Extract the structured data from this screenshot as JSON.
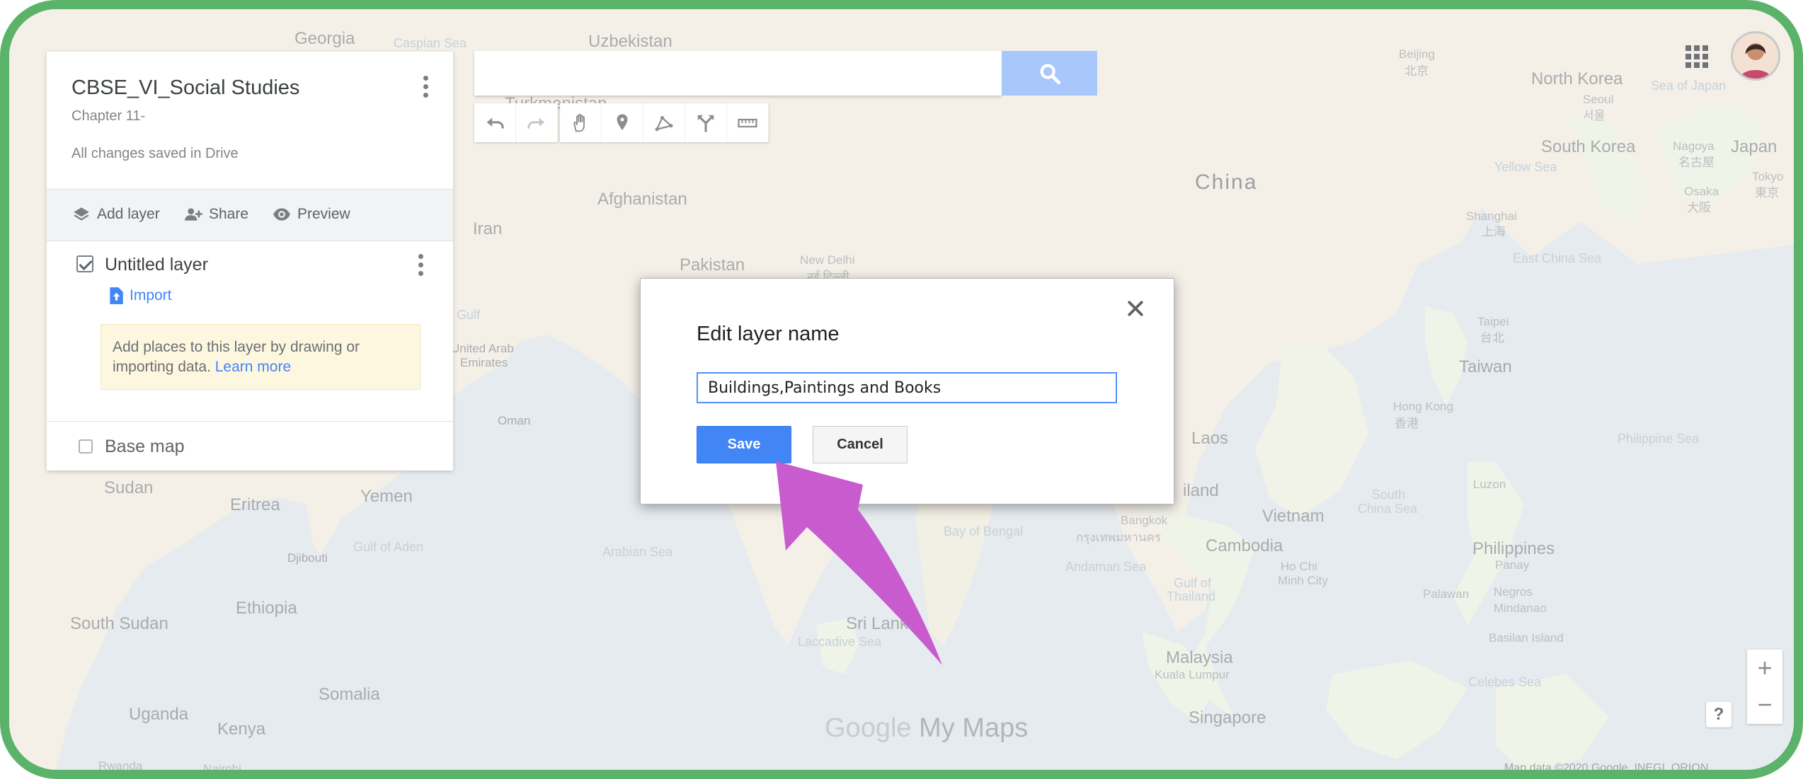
{
  "map": {
    "labels": {
      "georgia": "Georgia",
      "caspian": "Caspian Sea",
      "uzbekistan": "Uzbekistan",
      "turkmenistan": "Turkmenistan",
      "afghanistan": "Afghanistan",
      "iran": "Iran",
      "pakistan": "Pakistan",
      "new_delhi": "New Delhi",
      "new_delhi_local": "नई दिल्ली",
      "uae": "United Arab",
      "uae2": "Emirates",
      "gulf": "Gulf",
      "oman": "Oman",
      "sudan": "Sudan",
      "eritrea": "Eritrea",
      "yemen": "Yemen",
      "gulf_aden": "Gulf of Aden",
      "djibouti": "Djibouti",
      "arabian_sea": "Arabian Sea",
      "ethiopia": "Ethiopia",
      "south_sudan": "South Sudan",
      "somalia": "Somalia",
      "uganda": "Uganda",
      "kenya": "Kenya",
      "rwanda": "Rwanda",
      "nairobi": "Nairobi",
      "china": "China",
      "beijing": "Beijing",
      "beijing_local": "北京",
      "north_korea": "North Korea",
      "seoul": "Seoul",
      "seoul_local": "서울",
      "south_korea": "South Korea",
      "sea_japan": "Sea of Japan",
      "japan": "Japan",
      "nagoya": "Nagoya",
      "nagoya_local": "名古屋",
      "osaka": "Osaka",
      "osaka_local": "大阪",
      "tokyo": "Tokyo",
      "tokyo_local": "東京",
      "yellow_sea": "Yellow Sea",
      "shanghai": "Shanghai",
      "shanghai_local": "上海",
      "east_china_sea": "East China Sea",
      "taipei": "Taipei",
      "taipei_local": "台北",
      "taiwan": "Taiwan",
      "hong_kong": "Hong Kong",
      "hong_kong_local": "香港",
      "philippine_sea": "Philippine Sea",
      "laos": "Laos",
      "thailand": "iland",
      "vietnam": "Vietnam",
      "south_china_sea": "South",
      "south_china_sea2": "China Sea",
      "luzon": "Luzon",
      "bangkok": "Bangkok",
      "bangkok_local": "กรุงเทพมหานคร",
      "bay_bengal": "Bay of Bengal",
      "cambodia": "Cambodia",
      "ho_chi_minh": "Ho Chi",
      "ho_chi_minh2": "Minh City",
      "philippines": "Philippines",
      "panay": "Panay",
      "andaman": "Andaman Sea",
      "gulf_thailand": "Gulf of",
      "gulf_thailand2": "Thailand",
      "palawan": "Palawan",
      "negros": "Negros",
      "mindanao": "Mindanao",
      "sri_lanka": "Sri Lanka",
      "laccadive": "Laccadive Sea",
      "basilan": "Basilan Island",
      "malaysia": "Malaysia",
      "kuala_lumpur": "Kuala Lumpur",
      "celebes": "Celebes Sea",
      "singapore": "Singapore"
    },
    "watermark_google": "Google",
    "watermark_product": " My Maps",
    "attribution": "Map data ©2020 Google, INEGI, ORION"
  },
  "panel": {
    "title": "CBSE_VI_Social Studies",
    "subtitle": "Chapter 11-",
    "saved_status": "All changes saved in Drive",
    "actions": {
      "add_layer": "Add layer",
      "share": "Share",
      "preview": "Preview"
    },
    "layer": {
      "name": "Untitled layer",
      "import_label": "Import",
      "hint_text": "Add places to this layer by drawing or importing data. ",
      "hint_link": "Learn more"
    },
    "base_map_label": "Base map"
  },
  "search": {
    "placeholder": "",
    "value": ""
  },
  "toolbar": {
    "tools": [
      "undo-icon",
      "redo-icon",
      "hand-icon",
      "marker-icon",
      "draw-line-icon",
      "directions-icon",
      "ruler-icon"
    ]
  },
  "zoom": {
    "in": "+",
    "out": "−"
  },
  "help": "?",
  "dialog": {
    "title": "Edit layer name",
    "input_value": "Buildings,Paintings and Books",
    "save_label": "Save",
    "cancel_label": "Cancel"
  },
  "colors": {
    "frame": "#5bb36a",
    "primary": "#4285f4",
    "arrow": "#c85bce"
  }
}
